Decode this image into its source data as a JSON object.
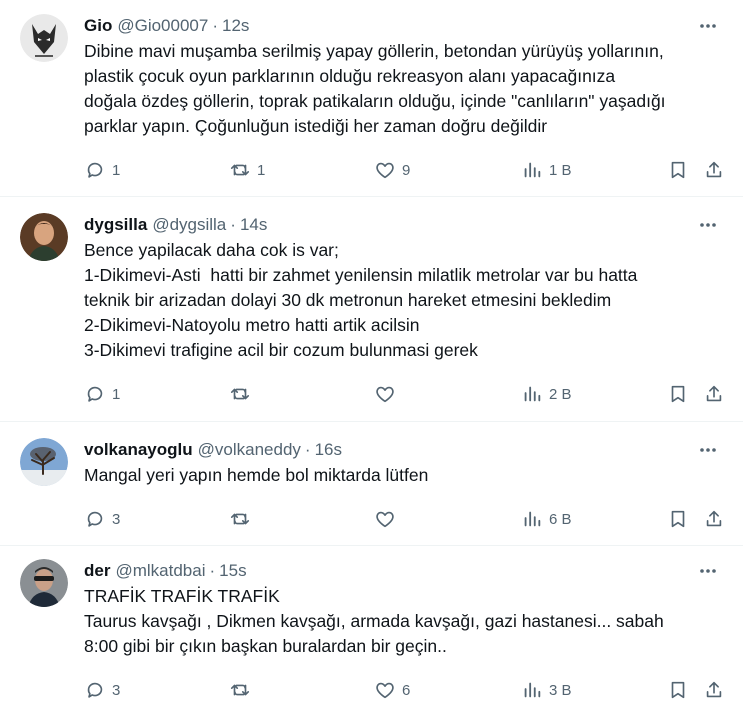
{
  "tweets": [
    {
      "name": "Gio",
      "handle": "@Gio00007",
      "time": "12s",
      "lines": [
        "Dibine mavi muşamba serilmiş yapay göllerin, betondan yürüyüş yollarının,",
        "plastik çocuk oyun parklarının olduğu rekreasyon alanı yapacağınıza",
        "doğala özdeş göllerin, toprak patikaların olduğu, içinde \"canlıların\" yaşadığı",
        "parklar yapın. Çoğunluğun istediği her zaman doğru değildir"
      ],
      "replies": "1",
      "retweets": "1",
      "likes": "9",
      "views": "1 B"
    },
    {
      "name": "dygsilla",
      "handle": "@dygsilla",
      "time": "14s",
      "lines": [
        "Bence yapilacak daha cok is var;",
        "1-Dikimevi-Asti  hatti bir zahmet yenilensin milatlik metrolar var bu hatta",
        "teknik bir arizadan dolayi 30 dk metronun hareket etmesini bekledim",
        "2-Dikimevi-Natoyolu metro hatti artik acilsin",
        "3-Dikimevi trafigine acil bir cozum bulunmasi gerek"
      ],
      "replies": "1",
      "retweets": "",
      "likes": "",
      "views": "2 B"
    },
    {
      "name": "volkanayoglu",
      "handle": "@volkaneddy",
      "time": "16s",
      "lines": [
        "Mangal yeri yapın hemde bol miktarda lütfen"
      ],
      "replies": "3",
      "retweets": "",
      "likes": "",
      "views": "6 B"
    },
    {
      "name": "der",
      "handle": "@mlkatdbai",
      "time": "15s",
      "lines": [
        "TRAFİK TRAFİK TRAFİK",
        "Taurus kavşağı , Dikmen kavşağı, armada kavşağı, gazi hastanesi... sabah",
        "8:00 gibi bir çıkın başkan buralardan bir geçin.."
      ],
      "replies": "3",
      "retweets": "",
      "likes": "6",
      "views": "3 B"
    }
  ],
  "colors": {
    "text": "#0f1419",
    "secondary": "#536471",
    "divider": "#eff3f4"
  },
  "icons": [
    "more-icon",
    "reply-icon",
    "retweet-icon",
    "like-icon",
    "views-icon",
    "bookmark-icon",
    "share-icon"
  ]
}
